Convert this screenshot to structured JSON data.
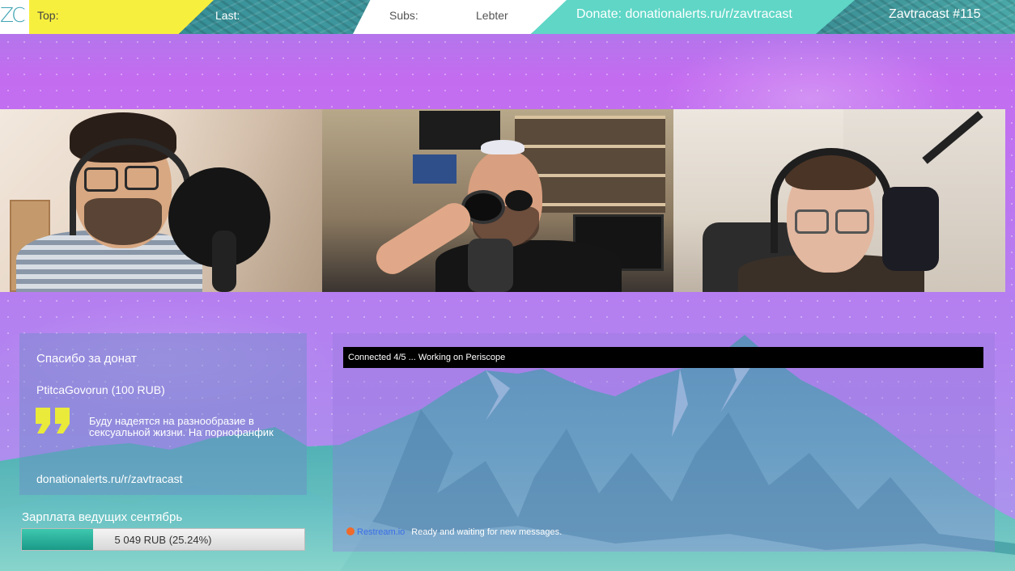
{
  "topbar": {
    "logo": "ZC",
    "top_label": "Top:",
    "last_label": "Last:",
    "subs_label": "Subs:",
    "subs_value": "Lebter",
    "donate": "Donate: donationalerts.ru/r/zavtracast",
    "episode": "Zavtracast #115"
  },
  "donation": {
    "title": "Спасибо за донат",
    "donor": "PtitcaGovorun (100 RUB)",
    "message": "Буду надеятся на разнообразие в сексуальной жизни. На порнофанфик",
    "url": "donationalerts.ru/r/zavtracast"
  },
  "chat": {
    "status": "Connected 4/5 ... Working on Periscope",
    "source": "Restream.io",
    "message": "Ready and waiting for new messages."
  },
  "goal": {
    "label": "Зарплата ведущих сентябрь",
    "amount": "5 049 RUB (25.24%)",
    "progress": 0.2524
  },
  "colors": {
    "yellow": "#f7ef3e",
    "teal": "#5fd6c6",
    "accent_quote": "#e9ea3a",
    "goal_fill": "#1fa692"
  },
  "icons": {
    "quote": "quote-icon",
    "restream": "restream-icon"
  }
}
